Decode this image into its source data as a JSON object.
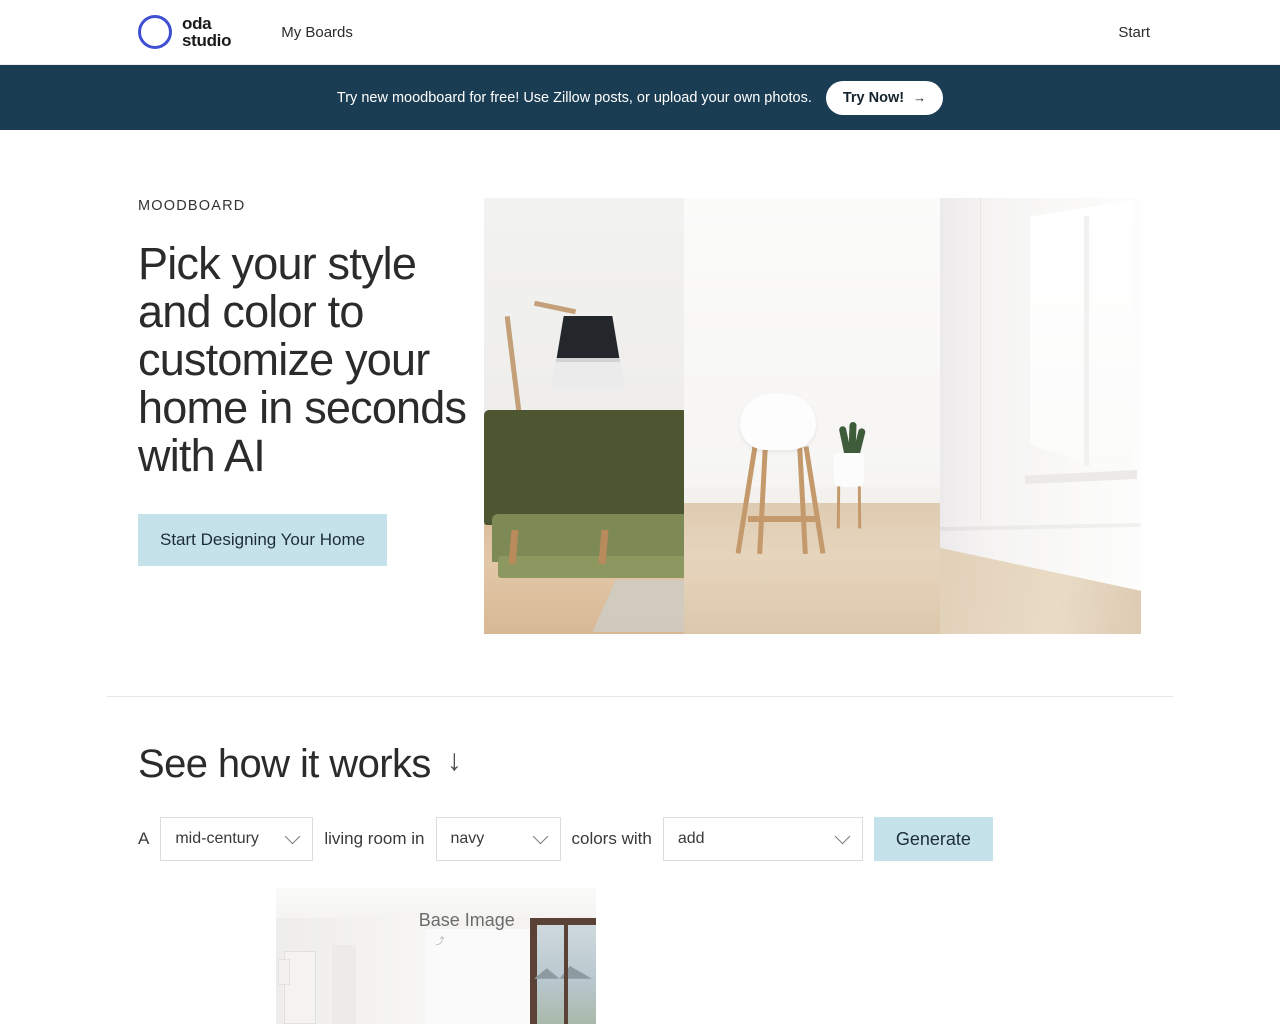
{
  "header": {
    "brand_line1": "oda",
    "brand_line2": "studio",
    "logo_icon": "circle-ring-logo",
    "logo_color": "#3f4fd1",
    "nav": {
      "my_boards": "My Boards"
    },
    "start_link": "Start"
  },
  "banner": {
    "message": "Try new moodboard for free! Use Zillow posts, or upload your own photos.",
    "button_label": "Try Now!",
    "button_arrow": "→",
    "background": "#1b3d53"
  },
  "hero": {
    "eyebrow": "MOODBOARD",
    "headline": "Pick your style and color to customize your home in seconds with AI",
    "cta_label": "Start Designing Your Home",
    "cta_color": "#c5e1ea",
    "image_alt": "living-room-collage"
  },
  "works": {
    "title": "See how it works",
    "arrow_icon": "↓",
    "sentence": {
      "lead": "A",
      "mid": "living room in",
      "tail": "colors with"
    },
    "style_select": {
      "value": "mid-century",
      "icon": "chevron-down-icon"
    },
    "color_select": {
      "value": "navy",
      "icon": "chevron-down-icon"
    },
    "add_select": {
      "value": "add",
      "icon": "chevron-down-icon"
    },
    "generate_label": "Generate",
    "generate_color": "#c5e1ea"
  },
  "base_image": {
    "label": "Base Image",
    "sub_mark": "⤴",
    "alt": "empty-white-room-with-window"
  }
}
